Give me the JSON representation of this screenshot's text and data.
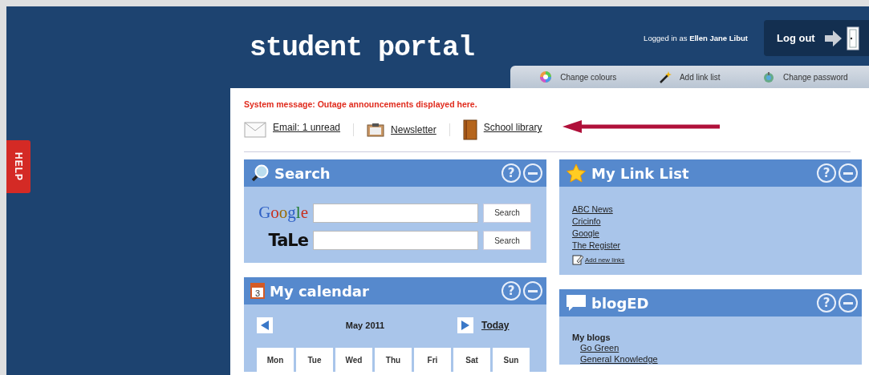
{
  "help_tab": "HELP",
  "header": {
    "title": "student portal",
    "logged_in_label": "Logged in as",
    "user_name": "Ellen Jane Libut",
    "logout": "Log out"
  },
  "toolbar_tabs": [
    {
      "label": "Change colours",
      "kind": "colours"
    },
    {
      "label": "Add link list",
      "kind": "wand"
    },
    {
      "label": "Change password",
      "kind": "password"
    }
  ],
  "system_message": "System message: Outage announcements displayed here.",
  "quick_links": [
    {
      "label": "Email: 1 unread",
      "kind": "email"
    },
    {
      "label": "Newsletter",
      "kind": "newsletter"
    },
    {
      "label": "School library",
      "kind": "library"
    }
  ],
  "columns": [
    [
      {
        "kind": "search",
        "title": "Search",
        "help_button": "?",
        "engines": [
          {
            "name": "Google",
            "button": "Search"
          },
          {
            "name": "TaLe",
            "button": "Search"
          }
        ]
      },
      {
        "kind": "calendar",
        "title": "My calendar",
        "help_button": "?",
        "icon_day": "3",
        "month": "May 2011",
        "today": "Today",
        "days": [
          "Mon",
          "Tue",
          "Wed",
          "Thu",
          "Fri",
          "Sat",
          "Sun"
        ]
      }
    ],
    [
      {
        "kind": "links",
        "title": "My Link List",
        "help_button": "?",
        "links": [
          "ABC News",
          "Cricinfo",
          "Google",
          "The Register"
        ],
        "add_link": "Add new links"
      },
      {
        "kind": "blog",
        "title": "blogED",
        "help_button": "?",
        "section": "My blogs",
        "blogs": [
          "Go Green",
          "General Knowledge"
        ]
      }
    ]
  ]
}
